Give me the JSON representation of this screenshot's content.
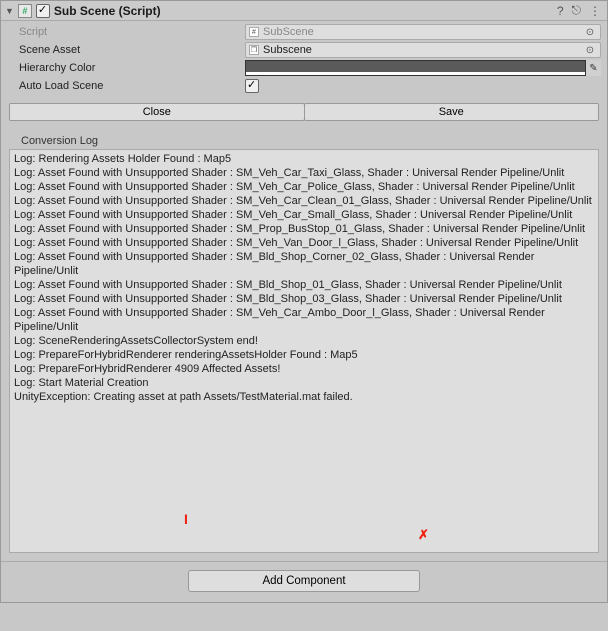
{
  "header": {
    "title": "Sub Scene (Script)",
    "enabled": true,
    "help_icon": "?",
    "preset_icon": "⎋",
    "menu_icon": "⋮",
    "foldout": "▼",
    "badge": "#"
  },
  "props": {
    "script": {
      "label": "Script",
      "value": "SubScene"
    },
    "scene_asset": {
      "label": "Scene Asset",
      "value": "Subscene"
    },
    "hierarchy_color": {
      "label": "Hierarchy Color"
    },
    "auto_load": {
      "label": "Auto Load Scene",
      "checked": true
    }
  },
  "buttons": {
    "close": "Close",
    "save": "Save",
    "add_component": "Add Component"
  },
  "log": {
    "label": "Conversion Log",
    "lines": [
      "Log: Rendering Assets Holder Found : Map5",
      "Log: Asset Found with Unsupported Shader : SM_Veh_Car_Taxi_Glass, Shader : Universal Render Pipeline/Unlit",
      "Log: Asset Found with Unsupported Shader : SM_Veh_Car_Police_Glass, Shader : Universal Render Pipeline/Unlit",
      "Log: Asset Found with Unsupported Shader : SM_Veh_Car_Clean_01_Glass, Shader : Universal Render Pipeline/Unlit",
      "Log: Asset Found with Unsupported Shader : SM_Veh_Car_Small_Glass, Shader : Universal Render Pipeline/Unlit",
      "Log: Asset Found with Unsupported Shader : SM_Prop_BusStop_01_Glass, Shader : Universal Render Pipeline/Unlit",
      "Log: Asset Found with Unsupported Shader : SM_Veh_Van_Door_l_Glass, Shader : Universal Render Pipeline/Unlit",
      "Log: Asset Found with Unsupported Shader : SM_Bld_Shop_Corner_02_Glass, Shader : Universal Render Pipeline/Unlit",
      "Log: Asset Found with Unsupported Shader : SM_Bld_Shop_01_Glass, Shader : Universal Render Pipeline/Unlit",
      "Log: Asset Found with Unsupported Shader : SM_Bld_Shop_03_Glass, Shader : Universal Render Pipeline/Unlit",
      "Log: Asset Found with Unsupported Shader : SM_Veh_Car_Ambo_Door_l_Glass, Shader : Universal Render Pipeline/Unlit",
      "Log: SceneRenderingAssetsCollectorSystem end!",
      "Log: PrepareForHybridRenderer renderingAssetsHolder Found : Map5",
      "Log: PrepareForHybridRenderer 4909 Affected Assets!",
      "Log: Start Material Creation",
      "UnityException: Creating asset at path Assets/TestMaterial.mat failed."
    ]
  },
  "annotations": {
    "mark_i": "I",
    "mark_x": "✗"
  }
}
